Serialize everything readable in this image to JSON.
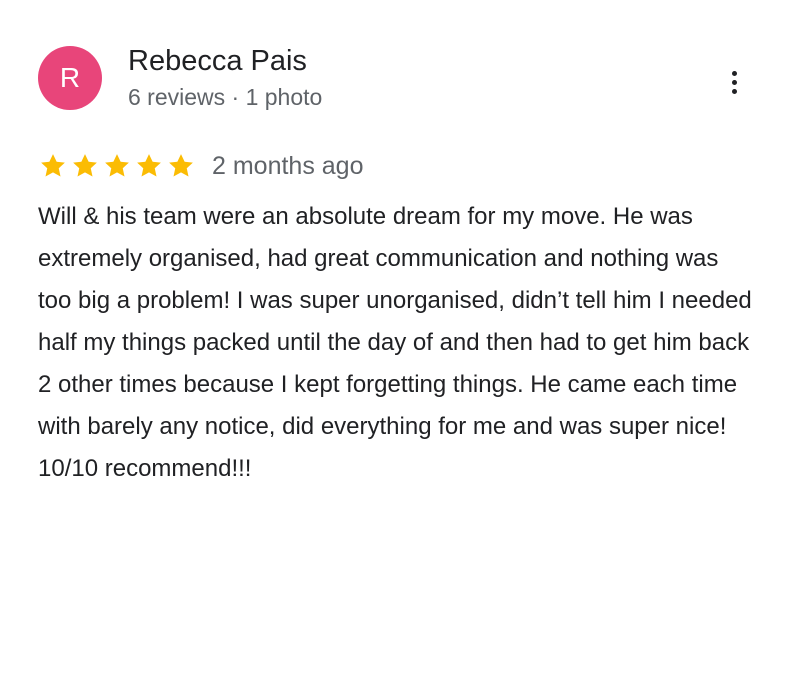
{
  "reviewer": {
    "initial": "R",
    "name": "Rebecca Pais",
    "meta": "6 reviews · 1 photo",
    "avatar_color": "#e8457a"
  },
  "menu": {
    "icon": "more-vert-icon"
  },
  "rating": {
    "stars": 5,
    "max_stars": 5,
    "star_color": "#fbbc04",
    "date": "2 months ago"
  },
  "review": {
    "text": "Will & his team were an absolute dream for my move. He was extremely organised, had great communication and nothing was too big a problem! I was super unorganised, didn’t tell him I needed half my things packed until the day of and then had to get him back 2 other times because I kept forgetting things. He came each time with barely any notice, did everything for me and was super nice! 10/10 recommend!!!"
  }
}
